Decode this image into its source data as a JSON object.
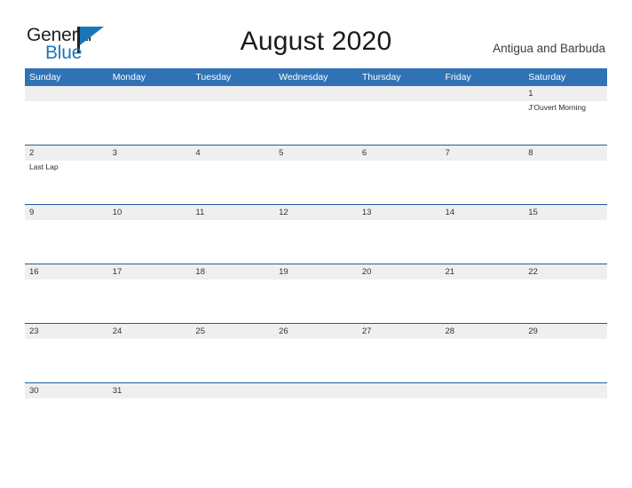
{
  "brand": {
    "name_part1": "General",
    "name_part2": "Blue"
  },
  "header": {
    "title": "August 2020",
    "region": "Antigua and Barbuda"
  },
  "colors": {
    "header_blue": "#3072b5",
    "divider_blue": "#1f5c9e",
    "date_band_gray": "#efefef",
    "brand_blue": "#1b75bb"
  },
  "calendar": {
    "day_headers": [
      "Sunday",
      "Monday",
      "Tuesday",
      "Wednesday",
      "Thursday",
      "Friday",
      "Saturday"
    ],
    "weeks": [
      {
        "dates": [
          "",
          "",
          "",
          "",
          "",
          "",
          "1"
        ],
        "events": [
          [],
          [],
          [],
          [],
          [],
          [],
          [
            "J’Ouvert Morning"
          ]
        ]
      },
      {
        "dates": [
          "2",
          "3",
          "4",
          "5",
          "6",
          "7",
          "8"
        ],
        "events": [
          [
            "Last Lap"
          ],
          [],
          [],
          [],
          [],
          [],
          []
        ]
      },
      {
        "dates": [
          "9",
          "10",
          "11",
          "12",
          "13",
          "14",
          "15"
        ],
        "events": [
          [],
          [],
          [],
          [],
          [],
          [],
          []
        ]
      },
      {
        "dates": [
          "16",
          "17",
          "18",
          "19",
          "20",
          "21",
          "22"
        ],
        "events": [
          [],
          [],
          [],
          [],
          [],
          [],
          []
        ]
      },
      {
        "dates": [
          "23",
          "24",
          "25",
          "26",
          "27",
          "28",
          "29"
        ],
        "events": [
          [],
          [],
          [],
          [],
          [],
          [],
          []
        ]
      },
      {
        "dates": [
          "30",
          "31",
          "",
          "",
          "",
          "",
          ""
        ],
        "events": [
          [],
          [],
          [],
          [],
          [],
          [],
          []
        ]
      }
    ]
  }
}
